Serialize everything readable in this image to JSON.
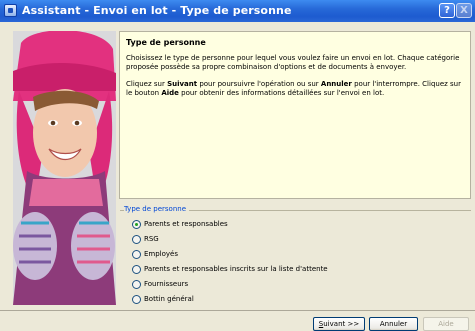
{
  "window": {
    "title": "Assistant - Envoi en lot - Type de personne",
    "help_button": "?",
    "close_button": "X"
  },
  "content": {
    "heading": "Type de personne",
    "paragraph1": "Choisissez le type de personne pour lequel vous voulez faire un envoi en lot. Chaque catégorie proposée possède sa propre combinaison d'options et de documents à envoyer.",
    "p2_a": "Cliquez sur ",
    "p2_suivant": "Suivant",
    "p2_b": " pour poursuivre l'opération ou sur ",
    "p2_annuler": "Annuler",
    "p2_c": " pour l'interrompre. Cliquez sur le bouton ",
    "p2_aide": "Aide",
    "p2_d": " pour obtenir des informations détaillées sur l'envoi en lot."
  },
  "group": {
    "legend": "Type de personne",
    "options": [
      {
        "label": "Parents et responsables",
        "checked": true
      },
      {
        "label": "RSG",
        "checked": false
      },
      {
        "label": "Employés",
        "checked": false
      },
      {
        "label": "Parents et responsables inscrits sur la liste d'attente",
        "checked": false
      },
      {
        "label": "Fournisseurs",
        "checked": false
      },
      {
        "label": "Bottin général",
        "checked": false
      }
    ]
  },
  "buttons": {
    "next_first": "S",
    "next_rest": "uivant >>",
    "cancel": "Annuler",
    "help": "Aide"
  }
}
